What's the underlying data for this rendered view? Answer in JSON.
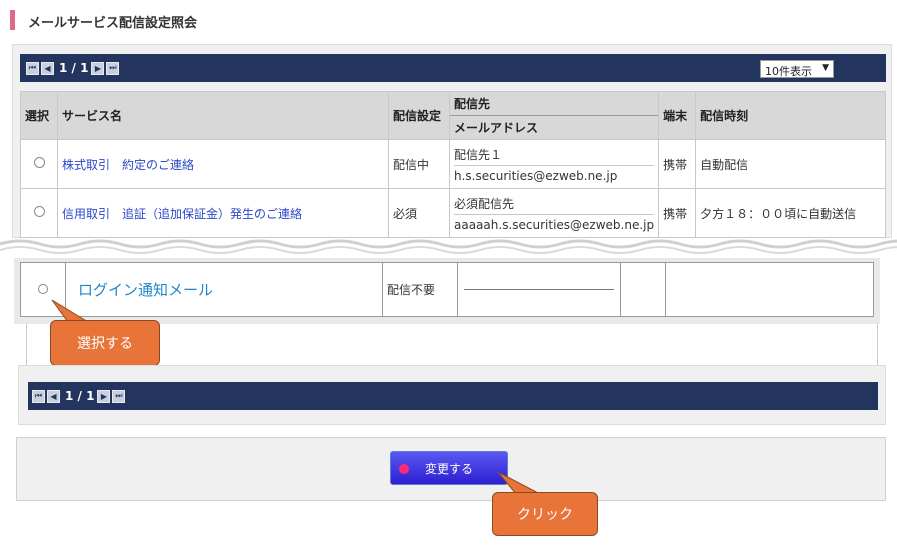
{
  "page": {
    "title": "メールサービス配信設定照会"
  },
  "pager": {
    "page_info": "1 / 1",
    "per_page": "10件表示"
  },
  "table": {
    "headers": {
      "select": "選択",
      "service": "サービス名",
      "setting": "配信設定",
      "dest": "配信先",
      "mail": "メールアドレス",
      "device": "端末",
      "time": "配信時刻"
    },
    "rows": [
      {
        "service": "株式取引　約定のご連絡",
        "setting": "配信中",
        "dest": "配信先１",
        "mail": "h.s.securities@ezweb.ne.jp",
        "device": "携帯",
        "time": "自動配信"
      },
      {
        "service": "信用取引　追証（追加保証金）発生のご連絡",
        "setting": "必須",
        "dest": "必須配信先",
        "mail": "aaaaah.s.securities@ezweb.ne.jp",
        "device": "携帯",
        "time": "夕方１８：００頃に自動送信"
      }
    ],
    "zoom_row": {
      "service": "ログイン通知メール",
      "setting": "配信不要"
    }
  },
  "callouts": {
    "select": "選択する",
    "click": "クリック"
  },
  "actions": {
    "change_label": "変更する"
  },
  "colors": {
    "navbar": "#23355f",
    "callout": "#e8743a",
    "accent": "#e06a8a"
  }
}
